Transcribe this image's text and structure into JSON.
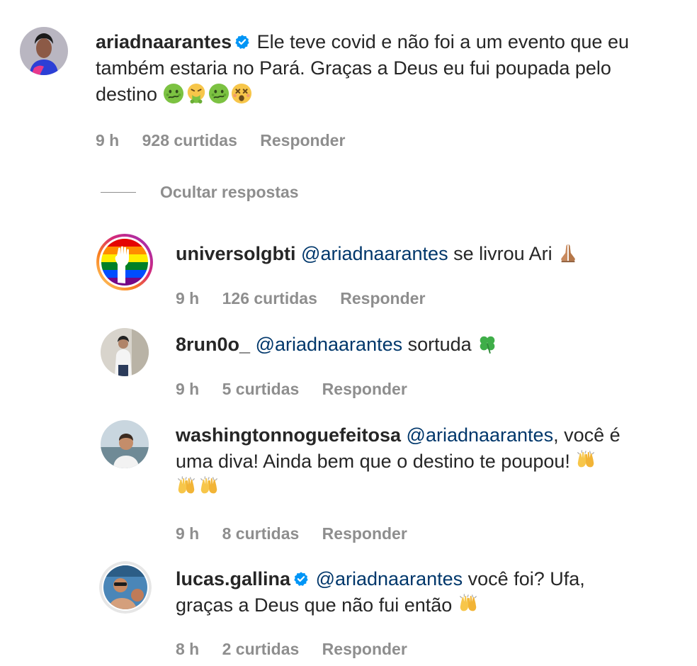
{
  "comments": [
    {
      "username": "ariadnaarantes",
      "verified": true,
      "text": "Ele teve covid e não foi a um evento que eu também estaria no Pará. Graças a Deus eu fui poupada pelo destino",
      "time": "9 h",
      "likes": "928 curtidas",
      "reply": "Responder"
    }
  ],
  "hide_replies_label": "Ocultar respostas",
  "replies": [
    {
      "username": "universolgbti",
      "mention": "@ariadnaarantes",
      "text": "se livrou Ari",
      "time": "9 h",
      "likes": "126 curtidas",
      "reply": "Responder"
    },
    {
      "username": "8run0o_",
      "mention": "@ariadnaarantes",
      "text": "sortuda",
      "time": "9 h",
      "likes": "5 curtidas",
      "reply": "Responder"
    },
    {
      "username": "washingtonnoguefeitosa",
      "mention": "@ariadnaarantes",
      "text_line1_tail": ", você é",
      "text_line2": "uma diva! Ainda bem que o destino te poupou!",
      "time": "9 h",
      "likes": "8 curtidas",
      "reply": "Responder"
    },
    {
      "username": "lucas.gallina",
      "verified": true,
      "mention": "@ariadnaarantes",
      "text_line1_tail": "você foi? Ufa,",
      "text_line2": "graças a Deus que não fui então",
      "time": "8 h",
      "likes": "2 curtidas",
      "reply": "Responder"
    }
  ],
  "colors": {
    "text": "#262626",
    "meta": "#8e8e8e",
    "mention": "#00376b",
    "verified": "#0095f6"
  },
  "icons": [
    "verified-badge-icon",
    "nauseated-face-emoji",
    "vomiting-face-emoji",
    "dizzy-face-emoji",
    "folded-hands-emoji",
    "four-leaf-clover-emoji",
    "raising-hands-emoji"
  ]
}
